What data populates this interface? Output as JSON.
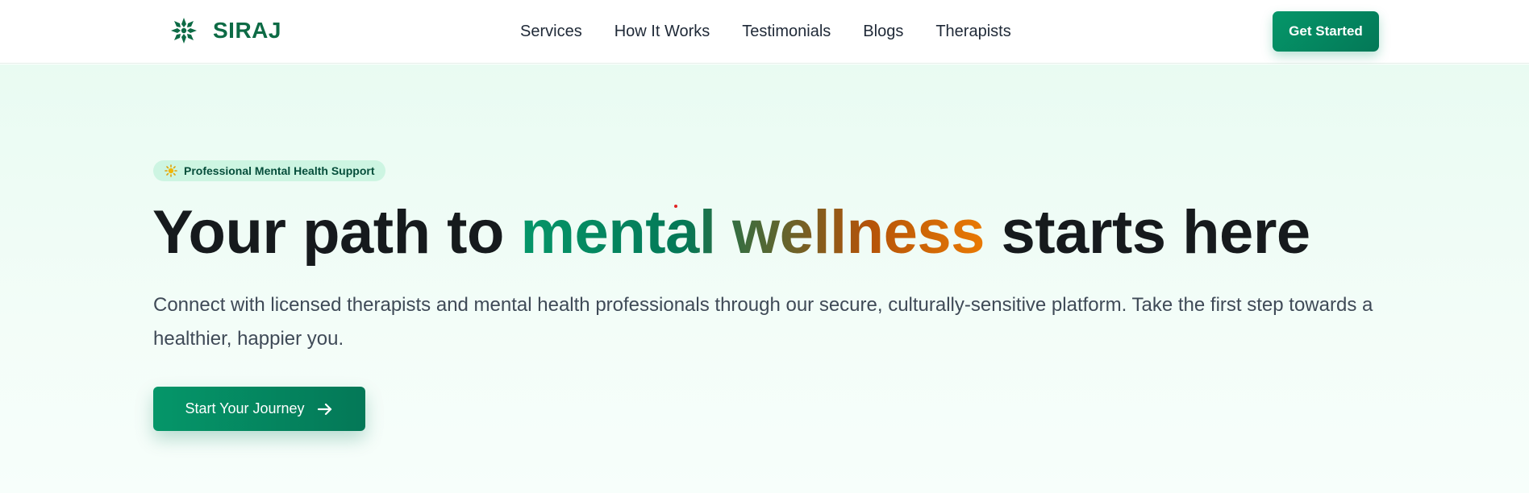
{
  "brand": {
    "name": "SIRAJ",
    "logo_icon": "star-flower-icon",
    "color": "#0d6b45"
  },
  "nav": {
    "items": [
      {
        "label": "Services"
      },
      {
        "label": "How It Works"
      },
      {
        "label": "Testimonials"
      },
      {
        "label": "Blogs"
      },
      {
        "label": "Therapists"
      }
    ],
    "cta_label": "Get Started"
  },
  "hero": {
    "badge": {
      "icon": "sun-icon",
      "text": "Professional Mental Health Support"
    },
    "headline": {
      "before": "Your path to ",
      "highlight": "mental wellness",
      "after": " starts here"
    },
    "description": "Connect with licensed therapists and mental health professionals through our secure, culturally-sensitive platform. Take the first step towards a healthier, happier you.",
    "cta": {
      "label": "Start Your Journey",
      "icon": "arrow-right-icon"
    }
  },
  "colors": {
    "primary": "#059669",
    "primary_dark": "#047857",
    "accent_orange": "#ea7a04",
    "hero_bg": "#e9fbf2"
  }
}
